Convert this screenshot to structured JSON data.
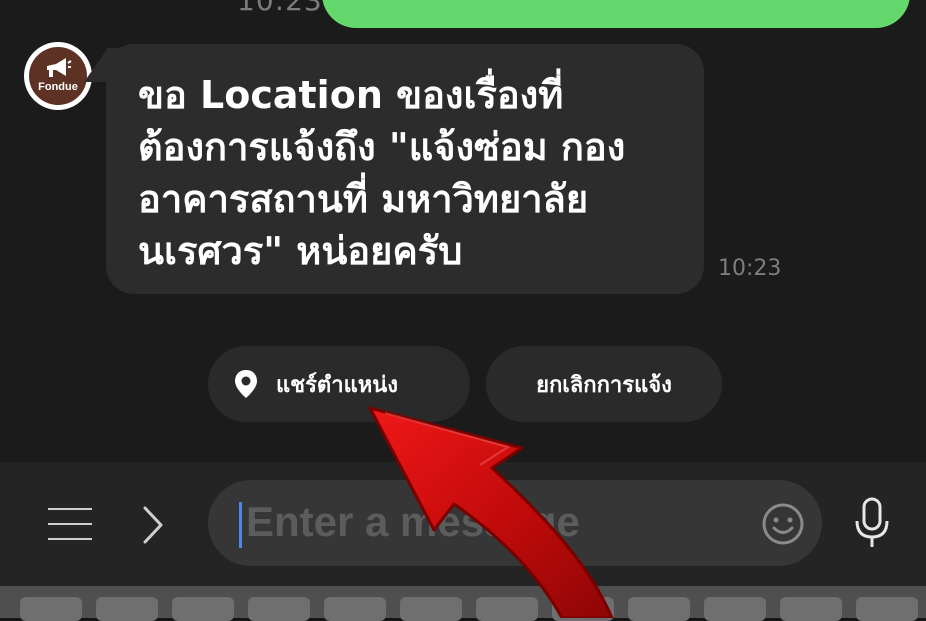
{
  "header": {
    "previous_time": "10:23"
  },
  "message": {
    "sender": "bot",
    "avatar_text": "Fondue",
    "text": "ขอ Location ของเรื่องที่\nต้องการแจ้งถึง \"แจ้งซ่อม กอง\nอาคารสถานที่ มหาวิทยาลัย\nนเรศวร\" หน่อยครับ",
    "time": "10:23"
  },
  "quick_replies": {
    "share_location": "แชร์ตำแหน่ง",
    "cancel_report": "ยกเลิกการแจ้ง"
  },
  "input": {
    "placeholder": "Enter a message"
  },
  "colors": {
    "sent_bubble": "#64d86d",
    "received_bubble": "#2c2c2c",
    "annotation_arrow": "#d40f0f",
    "caret": "#4e85e8"
  },
  "icons": {
    "menu": "menu-icon",
    "chevron": "chevron-right-icon",
    "emoji": "emoji-icon",
    "mic": "mic-icon",
    "pin": "location-pin-icon"
  }
}
